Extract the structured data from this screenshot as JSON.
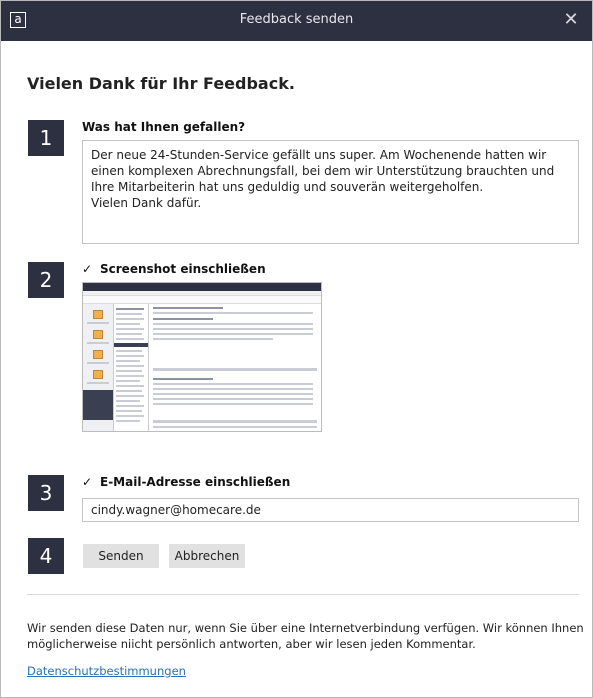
{
  "window": {
    "title": "Feedback senden",
    "app_icon": "a",
    "close_symbol": "✕"
  },
  "heading": "Vielen Dank für Ihr Feedback.",
  "steps": [
    {
      "number": "1",
      "label": "Was hat Ihnen gefallen?"
    },
    {
      "number": "2",
      "label": "Screenshot einschließen",
      "checked": true
    },
    {
      "number": "3",
      "label": "E-Mail-Adresse einschließen",
      "checked": true
    },
    {
      "number": "4"
    }
  ],
  "feedback_text": "Der neue 24-Stunden-Service gefällt uns super. Am Wochenende hatten wir einen komplexen Abrechnungsfall, bei dem wir Unterstützung brauchten und Ihre Mitarbeiterin hat uns geduldig und souverän weitergeholfen.\nVielen Dank dafür.",
  "email_value": "cindy.wagner@homecare.de",
  "check_symbol": "✓",
  "buttons": {
    "send": "Senden",
    "cancel": "Abbrechen"
  },
  "info_text": "Wir senden diese Daten nur, wenn Sie über eine Internetverbindung verfügen. Wir können Ihnen möglicherweise niicht persönlich antworten, aber wir lesen jeden Kommentar.",
  "privacy_link": "Datenschutzbestimmungen",
  "colors": {
    "titlebar": "#2c3041",
    "step_badge": "#2c3041",
    "button": "#e1e1e1",
    "link": "#2a6fb8"
  }
}
